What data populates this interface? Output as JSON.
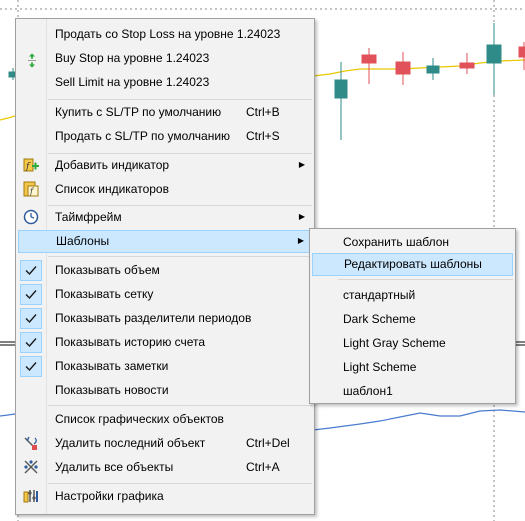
{
  "colors": {
    "menu_bg": "#f2f2f2",
    "highlight": "#cce8ff",
    "highlight_border": "#99d1ff",
    "candle_bull": "#2e8b88",
    "candle_bear": "#e0515a",
    "ma_line": "#e8c800",
    "indicator_line": "#4a7bd0"
  },
  "menu": {
    "trade_items": [
      {
        "label": "Продать со Stop Loss на уровне 1.24023",
        "icon": "sell-stop-loss"
      },
      {
        "label": "Buy Stop на уровне 1.24023",
        "icon": "buy-stop-arrow-icon"
      },
      {
        "label": "Sell Limit на уровне 1.24023",
        "icon": "sell-limit-arrow-icon"
      }
    ],
    "buy_default": {
      "label": "Купить с SL/TP по умолчанию",
      "shortcut": "Ctrl+B"
    },
    "sell_default": {
      "label": "Продать с SL/TP по умолчанию",
      "shortcut": "Ctrl+S"
    },
    "add_indicator": {
      "label": "Добавить индикатор",
      "icon": "add-indicator-icon"
    },
    "indicator_list": {
      "label": "Список индикаторов",
      "icon": "indicator-list-icon"
    },
    "timeframe": {
      "label": "Таймфрейм",
      "icon": "clock-icon"
    },
    "templates": {
      "label": "Шаблоны"
    },
    "show_volume": {
      "label": "Показывать объем",
      "checked": true
    },
    "show_grid": {
      "label": "Показывать сетку",
      "checked": true
    },
    "show_separators": {
      "label": "Показывать разделители периодов",
      "checked": true
    },
    "show_history": {
      "label": "Показывать историю счета",
      "checked": true
    },
    "show_notes": {
      "label": "Показывать заметки",
      "checked": true
    },
    "show_news": {
      "label": "Показывать новости",
      "checked": false
    },
    "object_list": {
      "label": "Список графических объектов"
    },
    "delete_last": {
      "label": "Удалить последний объект",
      "shortcut": "Ctrl+Del",
      "icon": "delete-last-icon"
    },
    "delete_all": {
      "label": "Удалить все объекты",
      "shortcut": "Ctrl+A",
      "icon": "delete-all-icon"
    },
    "chart_settings": {
      "label": "Настройки графика",
      "icon": "chart-settings-icon"
    }
  },
  "submenu": {
    "save_template": "Сохранить шаблон",
    "edit_templates": "Редактировать шаблоны",
    "templates": [
      "стандартный",
      "Dark Scheme",
      "Light Gray Scheme",
      "Light Scheme",
      "шаблон1"
    ]
  }
}
